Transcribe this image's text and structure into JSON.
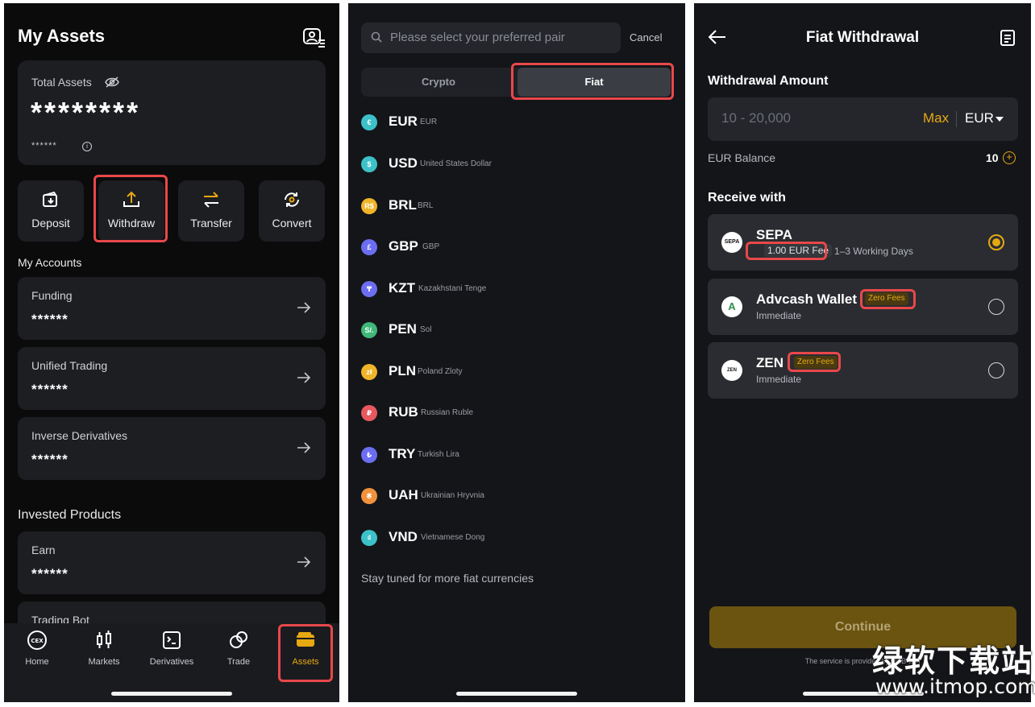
{
  "assets": {
    "title": "My Assets",
    "total_label": "Total Assets",
    "total_value": "********",
    "total_sub": "******",
    "actions": [
      {
        "label": "Deposit",
        "icon": "deposit-icon"
      },
      {
        "label": "Withdraw",
        "icon": "withdraw-icon"
      },
      {
        "label": "Transfer",
        "icon": "transfer-icon"
      },
      {
        "label": "Convert",
        "icon": "convert-icon"
      }
    ],
    "my_accounts_label": "My Accounts",
    "accounts": [
      {
        "name": "Funding",
        "value": "******"
      },
      {
        "name": "Unified Trading",
        "value": "******"
      },
      {
        "name": "Inverse Derivatives",
        "value": "******"
      }
    ],
    "invested_label": "Invested Products",
    "invested": [
      {
        "name": "Earn",
        "value": "******"
      },
      {
        "name": "Trading Bot",
        "value": ""
      }
    ],
    "tabs": [
      {
        "label": "Home",
        "icon": "cex-icon"
      },
      {
        "label": "Markets",
        "icon": "candlestick-icon"
      },
      {
        "label": "Derivatives",
        "icon": "derivatives-icon"
      },
      {
        "label": "Trade",
        "icon": "trade-icon"
      },
      {
        "label": "Assets",
        "icon": "wallet-icon",
        "active": true
      }
    ]
  },
  "select": {
    "search_placeholder": "Please select your preferred pair",
    "cancel": "Cancel",
    "seg_crypto": "Crypto",
    "seg_fiat": "Fiat",
    "currencies": [
      {
        "code": "EUR",
        "name": "EUR",
        "symbol": "€",
        "color": "#3cc1c9"
      },
      {
        "code": "USD",
        "name": "United States Dollar",
        "symbol": "$",
        "color": "#3cc1c9"
      },
      {
        "code": "BRL",
        "name": "BRL",
        "symbol": "R$",
        "color": "#f0b429"
      },
      {
        "code": "GBP",
        "name": "GBP",
        "symbol": "£",
        "color": "#6b6ef0"
      },
      {
        "code": "KZT",
        "name": "Kazakhstani Tenge",
        "symbol": "₸",
        "color": "#6b6ef0"
      },
      {
        "code": "PEN",
        "name": "Sol",
        "symbol": "S/.",
        "color": "#3fb87a"
      },
      {
        "code": "PLN",
        "name": "Poland Zloty",
        "symbol": "zł",
        "color": "#f0b429"
      },
      {
        "code": "RUB",
        "name": "Russian Ruble",
        "symbol": "₽",
        "color": "#e8585e"
      },
      {
        "code": "TRY",
        "name": "Turkish Lira",
        "symbol": "₺",
        "color": "#6b6ef0"
      },
      {
        "code": "UAH",
        "name": "Ukrainian Hryvnia",
        "symbol": "₴",
        "color": "#f0923c"
      },
      {
        "code": "VND",
        "name": "Vietnamese Dong",
        "symbol": "₫",
        "color": "#3cc1c9"
      }
    ],
    "more": "Stay tuned for more fiat currencies"
  },
  "withdraw": {
    "title": "Fiat Withdrawal",
    "amount_label": "Withdrawal Amount",
    "amount_placeholder": "10 - 20,000",
    "max": "Max",
    "currency": "EUR",
    "balance_label": "EUR Balance",
    "balance_value": "10",
    "receive_label": "Receive with",
    "methods": [
      {
        "name": "SEPA",
        "logo": "SEPA",
        "fee": "1.00 EUR Fee",
        "time": "1–3 Working Days",
        "selected": true
      },
      {
        "name": "Advcash Wallet",
        "logo": "A",
        "badge": "Zero Fees",
        "time": "Immediate",
        "selected": false
      },
      {
        "name": "ZEN",
        "logo": "ZEN",
        "badge": "Zero Fees",
        "time": "Immediate",
        "selected": false
      }
    ],
    "continue": "Continue",
    "footer": "The service is provided by UAB                  ech"
  },
  "watermark": {
    "line1": "绿软下载站",
    "line2": "www.itmop.com"
  },
  "colors": {
    "accent": "#e6a911",
    "highlight": "#e8484a",
    "background": "#141519"
  }
}
